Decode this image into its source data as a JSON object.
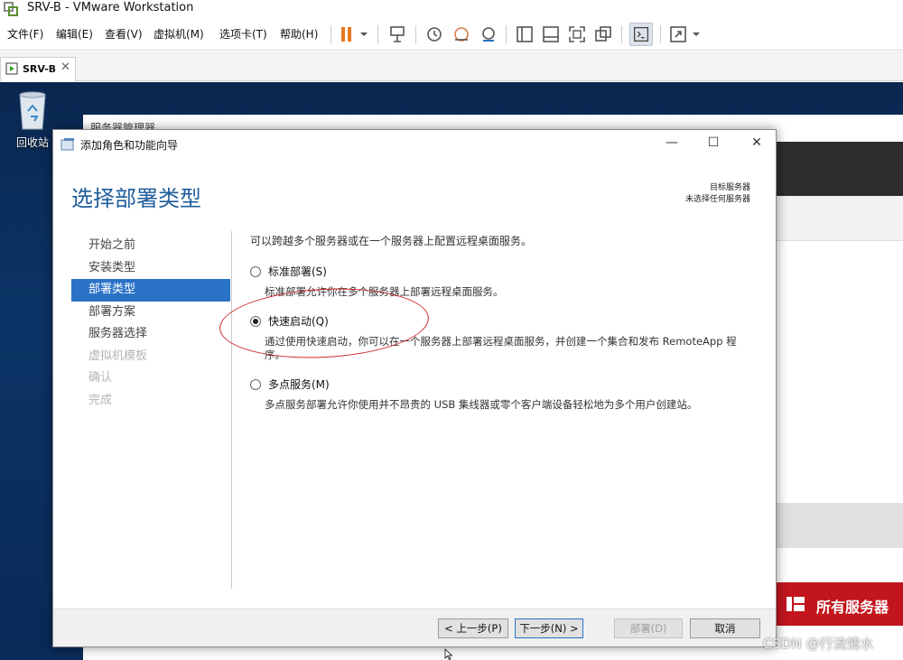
{
  "vmware": {
    "title": "SRV-B - VMware Workstation",
    "menu": [
      "文件(F)",
      "编辑(E)",
      "查看(V)",
      "虚拟机(M)",
      "选项卡(T)",
      "帮助(H)"
    ],
    "tab_label": "SRV-B",
    "tab_close": "✕"
  },
  "desktop": {
    "recycle_bin_label": "回收站"
  },
  "server_manager": {
    "title": "服务器管理器",
    "all_servers_label": "所有服务器"
  },
  "wizard": {
    "title": "添加角色和功能向导",
    "heading": "选择部署类型",
    "target_label": "目标服务器",
    "target_value": "未选择任何服务器",
    "nav": [
      "开始之前",
      "安装类型",
      "部署类型",
      "部署方案",
      "服务器选择",
      "虚拟机模板",
      "确认",
      "完成"
    ],
    "intro": "可以跨越多个服务器或在一个服务器上配置远程桌面服务。",
    "options": [
      {
        "label": "标准部署(S)",
        "desc": "标准部署允许你在多个服务器上部署远程桌面服务。",
        "selected": false
      },
      {
        "label": "快速启动(Q)",
        "desc": "通过使用快速启动，你可以在一个服务器上部署远程桌面服务，并创建一个集合和发布 RemoteApp 程序。",
        "selected": true
      },
      {
        "label": "多点服务(M)",
        "desc": "多点服务部署允许你使用并不昂贵的 USB 集线器或零个客户端设备轻松地为多个用户创建站。",
        "selected": false
      }
    ],
    "buttons": {
      "prev": "< 上一步(P)",
      "next": "下一步(N) >",
      "deploy": "部署(D)",
      "cancel": "取消"
    }
  },
  "watermark": "CSDN @行流情水"
}
